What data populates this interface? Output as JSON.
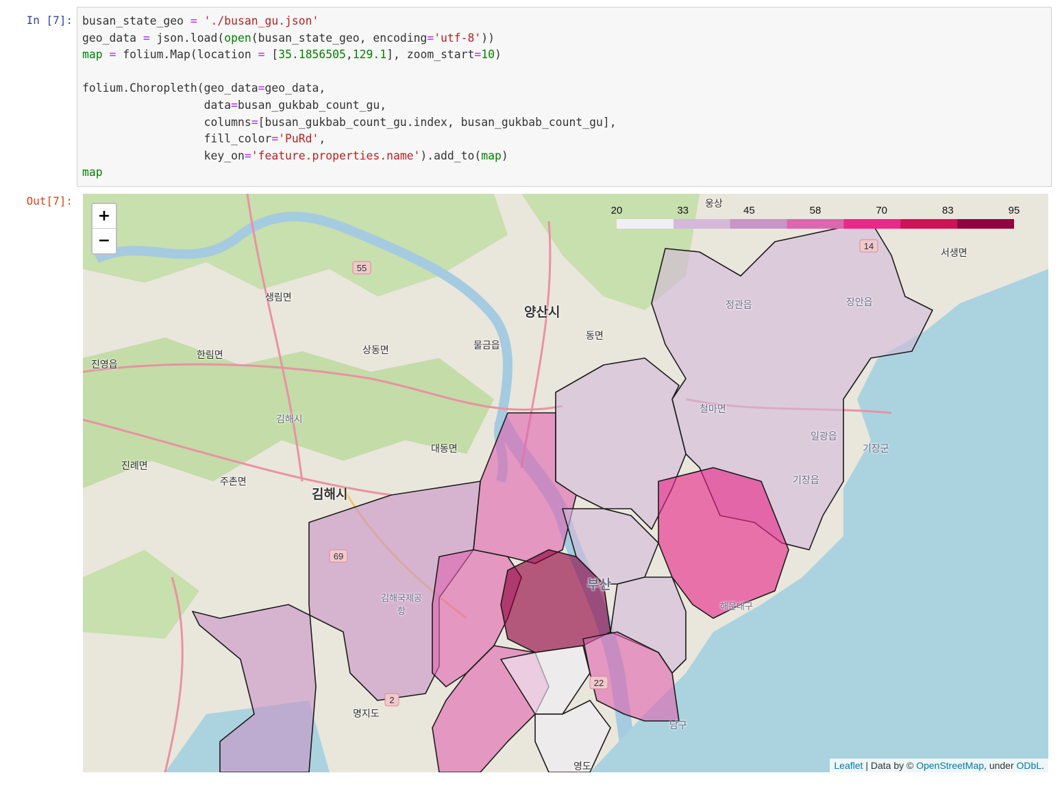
{
  "in_prompt": "In [7]:",
  "out_prompt": "Out[7]:",
  "code_lines": [
    [
      {
        "t": "busan_state_geo ",
        "c": ""
      },
      {
        "t": "=",
        "c": "op"
      },
      {
        "t": " ",
        "c": ""
      },
      {
        "t": "'./busan_gu.json'",
        "c": "str"
      }
    ],
    [
      {
        "t": "geo_data ",
        "c": ""
      },
      {
        "t": "=",
        "c": "op"
      },
      {
        "t": " json.load(",
        "c": ""
      },
      {
        "t": "open",
        "c": "kw"
      },
      {
        "t": "(busan_state_geo, encoding",
        "c": ""
      },
      {
        "t": "=",
        "c": "op"
      },
      {
        "t": "'utf-8'",
        "c": "str"
      },
      {
        "t": "))",
        "c": ""
      }
    ],
    [
      {
        "t": "map",
        "c": "var"
      },
      {
        "t": " ",
        "c": ""
      },
      {
        "t": "=",
        "c": "op"
      },
      {
        "t": " folium.Map(location ",
        "c": ""
      },
      {
        "t": "=",
        "c": "op"
      },
      {
        "t": " [",
        "c": ""
      },
      {
        "t": "35.1856505",
        "c": "num"
      },
      {
        "t": ",",
        "c": ""
      },
      {
        "t": "129.1",
        "c": "num"
      },
      {
        "t": "], zoom_start",
        "c": ""
      },
      {
        "t": "=",
        "c": "op"
      },
      {
        "t": "10",
        "c": "num"
      },
      {
        "t": ")",
        "c": ""
      }
    ],
    [
      {
        "t": "",
        "c": ""
      }
    ],
    [
      {
        "t": "folium.Choropleth(geo_data",
        "c": ""
      },
      {
        "t": "=",
        "c": "op"
      },
      {
        "t": "geo_data,",
        "c": ""
      }
    ],
    [
      {
        "t": "                  data",
        "c": ""
      },
      {
        "t": "=",
        "c": "op"
      },
      {
        "t": "busan_gukbab_count_gu,",
        "c": ""
      }
    ],
    [
      {
        "t": "                  columns",
        "c": ""
      },
      {
        "t": "=",
        "c": "op"
      },
      {
        "t": "[busan_gukbab_count_gu.index, busan_gukbab_count_gu],",
        "c": ""
      }
    ],
    [
      {
        "t": "                  fill_color",
        "c": ""
      },
      {
        "t": "=",
        "c": "op"
      },
      {
        "t": "'PuRd'",
        "c": "str"
      },
      {
        "t": ",",
        "c": ""
      }
    ],
    [
      {
        "t": "                  key_on",
        "c": ""
      },
      {
        "t": "=",
        "c": "op"
      },
      {
        "t": "'feature.properties.name'",
        "c": "str"
      },
      {
        "t": ").add_to(",
        "c": ""
      },
      {
        "t": "map",
        "c": "var"
      },
      {
        "t": ")",
        "c": ""
      }
    ],
    [
      {
        "t": "map",
        "c": "var"
      }
    ]
  ],
  "zoom": {
    "in_label": "+",
    "out_label": "−"
  },
  "legend": {
    "ticks": [
      "20",
      "33",
      "45",
      "58",
      "70",
      "83",
      "95"
    ],
    "colors": [
      "#f1eef6",
      "#d4b9da",
      "#c994c7",
      "#df65b0",
      "#e7298a",
      "#ce1256",
      "#91003f"
    ]
  },
  "attribution": {
    "leaflet": "Leaflet",
    "sep": " | Data by © ",
    "osm": "OpenStreetMap",
    "under": ", under ",
    "odbl": "ODbL",
    "end": "."
  },
  "place_labels": [
    "웅상",
    "서생면",
    "생림면",
    "양산시",
    "동면",
    "물금읍",
    "상동면",
    "한림면",
    "진영읍",
    "정관읍",
    "장안읍",
    "철마면",
    "김해시",
    "기장군",
    "일광읍",
    "대동면",
    "진례면",
    "주촌면",
    "김해시",
    "기장읍",
    "김해국제공항",
    "부산",
    "해운대구",
    "명지도",
    "남구",
    "영도"
  ],
  "road_labels": [
    "55",
    "69",
    "14",
    "22",
    "2"
  ]
}
